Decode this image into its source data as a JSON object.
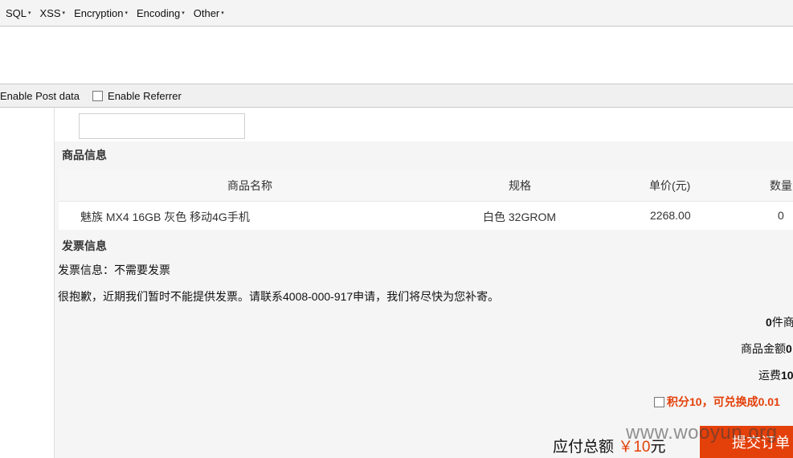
{
  "toolbar": {
    "menus": [
      "SQL",
      "XSS",
      "Encryption",
      "Encoding",
      "Other"
    ],
    "caret": "▾"
  },
  "options": {
    "enable_post": "Enable Post data",
    "enable_referrer": "Enable Referrer"
  },
  "product": {
    "section_title": "商品信息",
    "headers": [
      "商品名称",
      "规格",
      "单价(元)",
      "数量"
    ],
    "row": [
      "魅族 MX4 16GB 灰色 移动4G手机",
      "白色 32GROM",
      "2268.00",
      "0"
    ]
  },
  "invoice": {
    "section_title": "发票信息",
    "line1": "发票信息：不需要发票",
    "line2": "很抱歉，近期我们暂时不能提供发票。请联系4008-000-917申请，我们将尽快为您补寄。"
  },
  "summary": {
    "count_num": "0",
    "count_text": "件商",
    "amount_label": "商品金额",
    "amount_value": "0",
    "shipping_label": "运费",
    "shipping_value": "10",
    "points_text": "积分10，可兑换成0.01"
  },
  "total": {
    "label": "应付总额",
    "currency": "￥",
    "amount": "10",
    "unit": "元"
  },
  "submit_label": "提交订单",
  "watermark": "www.wooyun.org",
  "colors": {
    "accent": "#e4400a"
  }
}
